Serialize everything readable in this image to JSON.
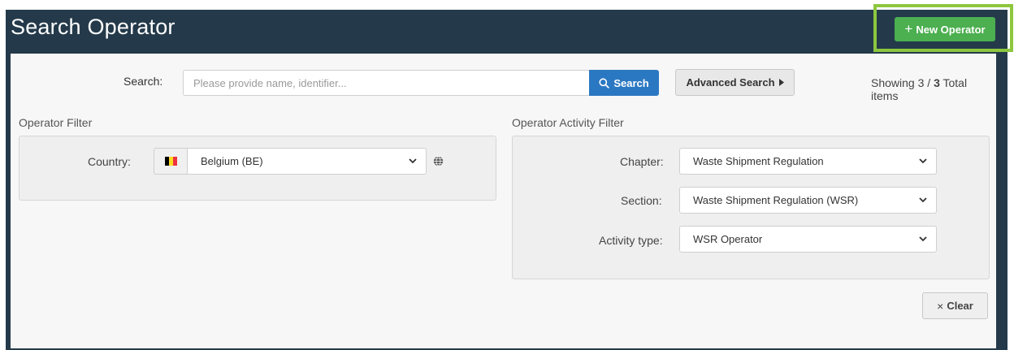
{
  "header": {
    "title": "Search Operator",
    "new_button_label": "New Operator"
  },
  "search": {
    "label": "Search:",
    "placeholder": "Please provide name, identifier...",
    "value": "",
    "button_label": "Search",
    "advanced_label": "Advanced Search",
    "showing_prefix": "Showing 3 / ",
    "showing_total": "3",
    "showing_suffix": " Total items"
  },
  "operator_filter": {
    "title": "Operator Filter",
    "country_label": "Country:",
    "country_value": "Belgium (BE)"
  },
  "activity_filter": {
    "title": "Operator Activity Filter",
    "chapter_label": "Chapter:",
    "chapter_value": "Waste Shipment Regulation",
    "section_label": "Section:",
    "section_value": "Waste Shipment Regulation (WSR)",
    "activity_label": "Activity type:",
    "activity_value": "WSR Operator"
  },
  "actions": {
    "clear_label": "Clear"
  },
  "colors": {
    "header_bg": "#243a4a",
    "primary": "#2b78c2",
    "success": "#4caf50",
    "highlight": "#8dc63f"
  },
  "icons": {
    "new": "plus-icon",
    "search": "search-icon",
    "advanced": "caret-right-icon",
    "flag": "belgium-flag-icon",
    "globe": "globe-icon",
    "clear": "close-icon",
    "dropdown": "chevron-down-icon"
  }
}
